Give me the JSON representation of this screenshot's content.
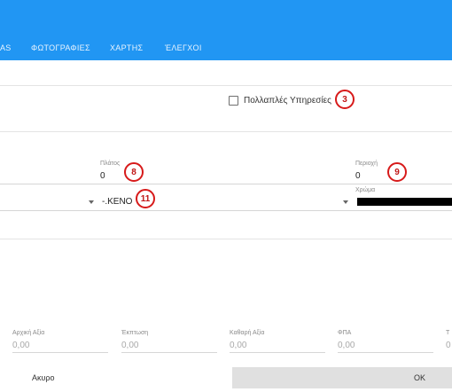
{
  "tabs": [
    {
      "label": "ΑS"
    },
    {
      "label": "ΦΩΤΟΓΡΑΦΙΕΣ"
    },
    {
      "label": "ΧΑΡΤΗΣ"
    },
    {
      "label": "ΈΛΕΓΧΟΙ"
    }
  ],
  "multiple_services": {
    "label": "Πολλαπλές Υπηρεσίες",
    "checked": false
  },
  "badges": [
    "3",
    "8",
    "9",
    "11"
  ],
  "fields": {
    "width": {
      "label": "Πλάτος",
      "value": "0"
    },
    "perimeter": {
      "label": "Περιοχή",
      "value": "0"
    },
    "dropdown_value": "-.ΚΕΝΟ",
    "color": {
      "label": "Χρώμα",
      "value_color": "#000000"
    }
  },
  "amounts": {
    "initial_value": {
      "label": "Αρχική Αξία",
      "value": "0,00"
    },
    "discount": {
      "label": "Έκπτωση",
      "value": "0,00"
    },
    "net_value": {
      "label": "Καθαρή Αξία",
      "value": "0,00"
    },
    "vat": {
      "label": "ΦΠΑ",
      "value": "0,00"
    },
    "total": {
      "label": "Τ",
      "value": "0"
    }
  },
  "footer": {
    "cancel_label": "Ακυρο",
    "ok_label": "ΟΚ"
  },
  "colors": {
    "header": "#2196f3",
    "badge_border": "#d71a1a",
    "ok_button_bg": "#e0e0e0"
  }
}
